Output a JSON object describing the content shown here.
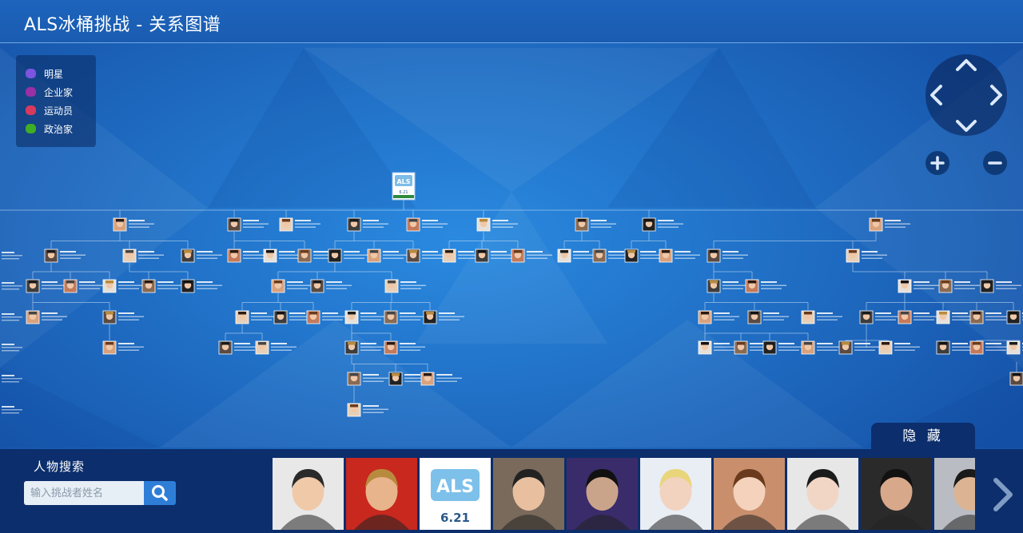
{
  "app": {
    "title": "ALS冰桶挑战 - 关系图谱"
  },
  "legend": [
    {
      "label": "明星",
      "color": "#7b55e0"
    },
    {
      "label": "企业家",
      "color": "#9a2fa6"
    },
    {
      "label": "运动员",
      "color": "#d83a5e"
    },
    {
      "label": "政治家",
      "color": "#3fae24"
    }
  ],
  "nav": {
    "up_icon": "chevron-up-icon",
    "down_icon": "chevron-down-icon",
    "left_icon": "chevron-left-icon",
    "right_icon": "chevron-right-icon",
    "zoom_in_icon": "plus-icon",
    "zoom_out_icon": "minus-icon"
  },
  "graph": {
    "root": {
      "logo_text": "ALS",
      "date": "6.21"
    }
  },
  "panel": {
    "hide_label": "隐 藏",
    "search_label": "人物搜索",
    "search_placeholder": "输入挑战者姓名",
    "search_icon": "search-icon",
    "next_icon": "chevron-right-icon"
  },
  "thumbnails": [
    {
      "kind": "person",
      "bg": "#e8e8e8",
      "skin": "#f0c9a8",
      "hair": "#2a2a2a"
    },
    {
      "kind": "person",
      "bg": "#c8281e",
      "skin": "#e8b48c",
      "hair": "#b88a3e"
    },
    {
      "kind": "logo",
      "logo_text": "ALS",
      "date": "6.21",
      "bg": "#ffffff"
    },
    {
      "kind": "person",
      "bg": "#7a6a5c",
      "skin": "#e8c0a0",
      "hair": "#222222"
    },
    {
      "kind": "person",
      "bg": "#3a2b6b",
      "skin": "#caa48a",
      "hair": "#111111"
    },
    {
      "kind": "person",
      "bg": "#e9edf4",
      "skin": "#f2d3c0",
      "hair": "#e9d57a"
    },
    {
      "kind": "person",
      "bg": "#c98f6d",
      "skin": "#f4d2bc",
      "hair": "#6b3a1c"
    },
    {
      "kind": "person",
      "bg": "#e7e7e7",
      "skin": "#f1d6c6",
      "hair": "#1b1b1b"
    },
    {
      "kind": "person",
      "bg": "#2a2a2a",
      "skin": "#d8a88a",
      "hair": "#111111"
    },
    {
      "kind": "person",
      "bg": "#b9bcc2",
      "skin": "#dcb494",
      "hair": "#1a1a1a"
    }
  ]
}
